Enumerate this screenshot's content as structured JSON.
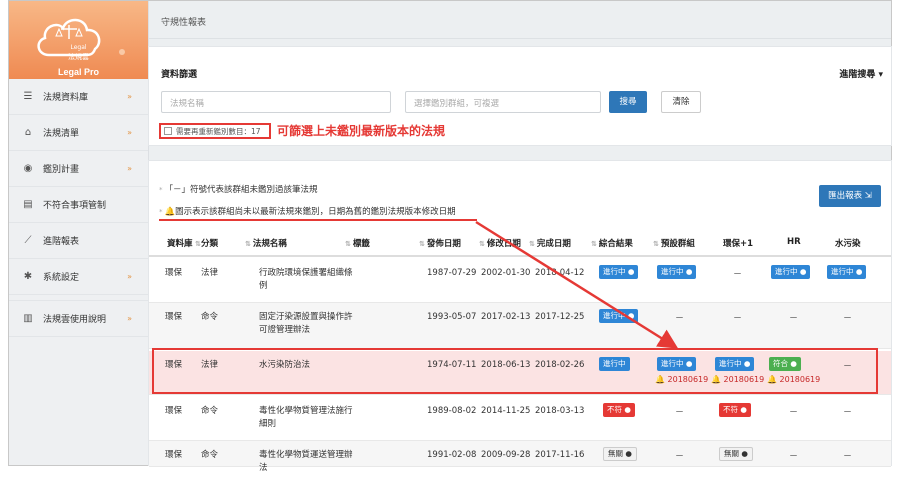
{
  "app": {
    "brand_line": "法規雲",
    "brand_small": "Legal",
    "product": "Legal Pro"
  },
  "sidebar": {
    "items": [
      {
        "label": "法規資料庫",
        "icon": "list-icon",
        "chevron": "»"
      },
      {
        "label": "法規清單",
        "icon": "home-icon",
        "chevron": "»"
      },
      {
        "label": "鑑別計畫",
        "icon": "eye-icon",
        "chevron": "»"
      },
      {
        "label": "不符合事項管制",
        "icon": "clipboard-icon",
        "chevron": ""
      },
      {
        "label": "進階報表",
        "icon": "line-chart-icon",
        "chevron": ""
      },
      {
        "label": "系統設定",
        "icon": "gear-icon",
        "chevron": "»"
      },
      {
        "label": "法規雲使用說明",
        "icon": "book-icon",
        "chevron": "»"
      }
    ]
  },
  "header": {
    "title": "守規性報表"
  },
  "filter": {
    "title": "資料篩選",
    "advanced": "進階搜尋 ▾",
    "name_placeholder": "法規名稱",
    "group_placeholder": "選擇鑑別群組，可複選",
    "search_label": "搜尋",
    "clear_label": "清除",
    "checkbox_label": "需要再重新鑑別數目：17",
    "annotation": "可篩選上未鑑別最新版本的法規"
  },
  "table": {
    "legend1": "「－」符號代表該群組未鑑別過該筆法規",
    "legend2": "圖示表示該群組尚未以最新法規來鑑別，日期為舊的鑑別法規版本修改日期",
    "export_label": "匯出報表",
    "columns": [
      "資料庫",
      "分類",
      "法規名稱",
      "標籤",
      "發佈日期",
      "修改日期",
      "完成日期",
      "綜合結果",
      "預設群組",
      "環保+1",
      "HR",
      "水污染"
    ],
    "rows": [
      {
        "db": "環保",
        "cat": "法律",
        "name": "行政院環境保護署組織條例",
        "pub": "1987-07-29",
        "mod": "2002-01-30",
        "done": "2018-04-12",
        "overall": "進行中",
        "g1": "進行中",
        "g2": "－",
        "g3": "進行中",
        "g4": "進行中"
      },
      {
        "db": "環保",
        "cat": "命令",
        "name": "固定汙染源設置與操作許可證管理辦法",
        "pub": "1993-05-07",
        "mod": "2017-02-13",
        "done": "2017-12-25",
        "overall": "進行中",
        "g1": "－",
        "g2": "－",
        "g3": "－",
        "g4": "－"
      },
      {
        "db": "環保",
        "cat": "法律",
        "name": "水污染防治法",
        "pub": "1974-07-11",
        "mod": "2018-06-13",
        "done": "2018-02-26",
        "overall": "進行中",
        "g1": "進行中",
        "g2": "進行中",
        "g3": "符合",
        "g4": "－",
        "warn1": "20180619",
        "warn2": "20180619",
        "warn3": "20180619"
      },
      {
        "db": "環保",
        "cat": "命令",
        "name": "毒性化學物質管理法施行細則",
        "pub": "1989-08-02",
        "mod": "2014-11-25",
        "done": "2018-03-13",
        "overall": "不符",
        "g1": "－",
        "g2": "不符",
        "g3": "－",
        "g4": "－"
      },
      {
        "db": "環保",
        "cat": "命令",
        "name": "毒性化學物質運送管理辦法",
        "pub": "1991-02-08",
        "mod": "2009-09-28",
        "done": "2017-11-16",
        "overall": "無關",
        "g1": "－",
        "g2": "無關",
        "g3": "－",
        "g4": "－"
      }
    ]
  },
  "colors": {
    "accent": "#2e77b8",
    "status_blue": "#2e86d6",
    "alert_red": "#e53935",
    "sidebar_orange": "#ef8a52",
    "status_green": "#4caf50"
  }
}
